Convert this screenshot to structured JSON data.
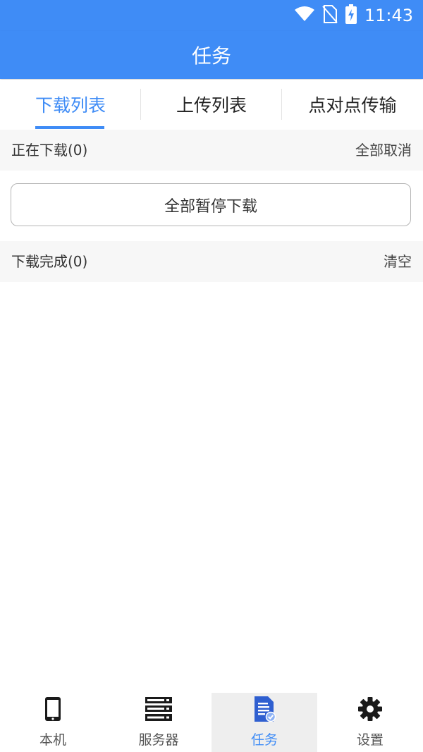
{
  "status_bar": {
    "time": "11:43"
  },
  "app_bar": {
    "title": "任务"
  },
  "tabs": [
    {
      "label": "下载列表",
      "active": true
    },
    {
      "label": "上传列表",
      "active": false
    },
    {
      "label": "点对点传输",
      "active": false
    }
  ],
  "downloading": {
    "title": "正在下载(0)",
    "action": "全部取消"
  },
  "pause_all_label": "全部暂停下载",
  "completed": {
    "title": "下载完成(0)",
    "action": "清空"
  },
  "bottom_nav": [
    {
      "label": "本机",
      "icon": "phone-icon",
      "active": false
    },
    {
      "label": "服务器",
      "icon": "server-icon",
      "active": false
    },
    {
      "label": "任务",
      "icon": "task-document-icon",
      "active": true
    },
    {
      "label": "设置",
      "icon": "gear-icon",
      "active": false
    }
  ],
  "colors": {
    "accent": "#3f8cf6",
    "section_bg": "#f7f7f7",
    "nav_active_bg": "#eeeeee"
  }
}
